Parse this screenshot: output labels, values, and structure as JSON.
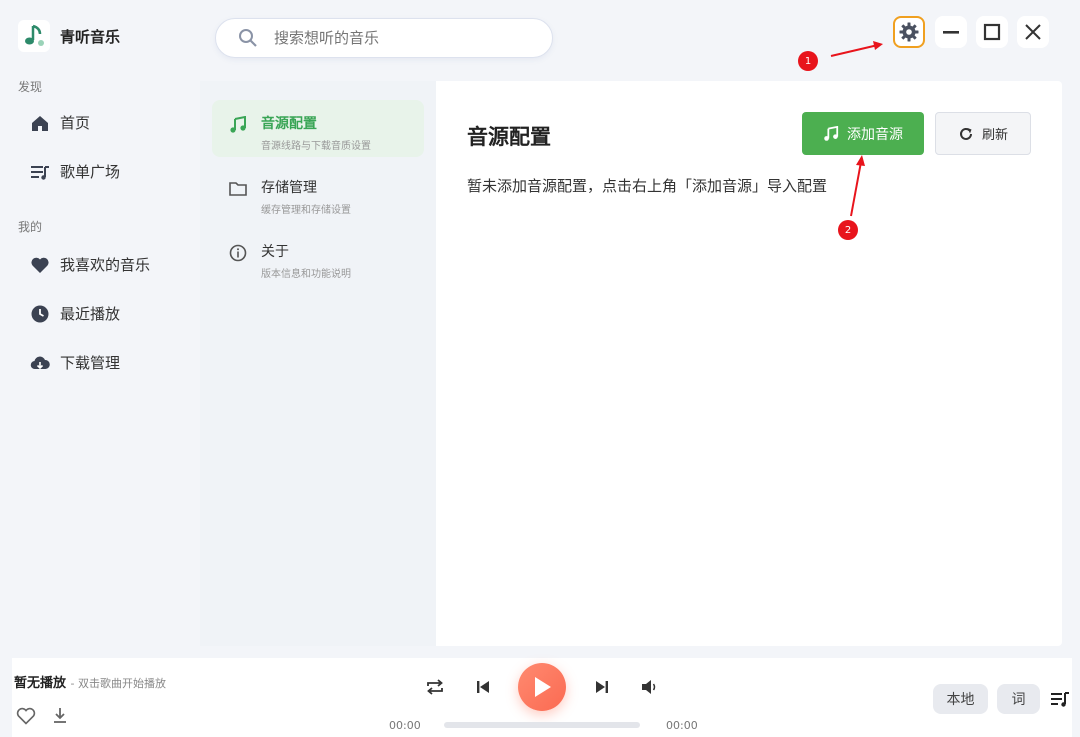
{
  "app": {
    "name": "青听音乐"
  },
  "sidebar": {
    "section_discover": "发现",
    "section_mine": "我的",
    "items": [
      {
        "label": "首页",
        "icon": "home-icon"
      },
      {
        "label": "歌单广场",
        "icon": "playlist-icon"
      },
      {
        "label": "我喜欢的音乐",
        "icon": "heart-icon"
      },
      {
        "label": "最近播放",
        "icon": "clock-icon"
      },
      {
        "label": "下载管理",
        "icon": "cloud-download-icon"
      }
    ]
  },
  "search": {
    "placeholder": "搜索想听的音乐",
    "value": ""
  },
  "settings": {
    "tabs": [
      {
        "title": "音源配置",
        "desc": "音源线路与下载音质设置",
        "icon": "music-note-icon",
        "active": true
      },
      {
        "title": "存储管理",
        "desc": "缓存管理和存储设置",
        "icon": "folder-icon",
        "active": false
      },
      {
        "title": "关于",
        "desc": "版本信息和功能说明",
        "icon": "info-icon",
        "active": false
      }
    ],
    "page_title": "音源配置",
    "empty_text": "暂未添加音源配置，点击右上角「添加音源」导入配置",
    "add_button": "添加音源",
    "refresh_button": "刷新"
  },
  "annotations": {
    "badge_1": "1",
    "badge_2": "2"
  },
  "player": {
    "title": "暂无播放",
    "subtitle": "- 双击歌曲开始播放",
    "current_time": "00:00",
    "total_time": "00:00",
    "progress": 0,
    "local_button": "本地",
    "lyrics_button": "词"
  },
  "colors": {
    "accent": "#4caf50",
    "play": "#fb6a52",
    "annotation": "#e8141c"
  }
}
